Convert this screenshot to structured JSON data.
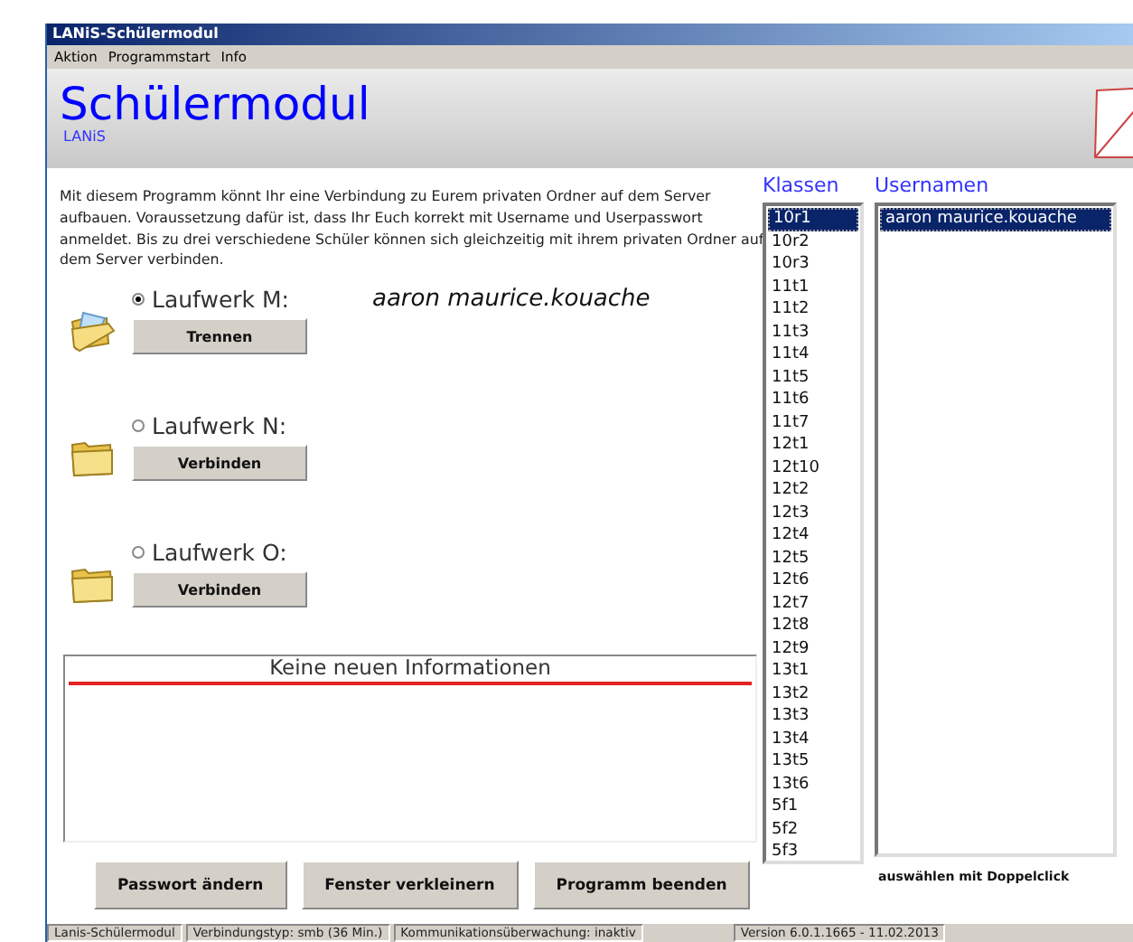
{
  "window": {
    "title": "LANiS-Schülermodul"
  },
  "menu": [
    "Aktion",
    "Programmstart",
    "Info"
  ],
  "header": {
    "title": "Schülermodul",
    "subtitle": "LANiS"
  },
  "description": "Mit diesem Programm könnt Ihr eine Verbindung zu Eurem privaten Ordner auf dem Server aufbauen. Voraussetzung dafür ist, dass Ihr Euch korrekt mit Username und Userpasswort anmeldet. Bis zu drei verschiedene Schüler können sich gleichzeitig mit ihrem privaten Ordner auf dem Server verbinden.",
  "drives": [
    {
      "label": "Laufwerk M:",
      "selected": true,
      "connected": true,
      "user": "aaron maurice.kouache",
      "button": "Trennen"
    },
    {
      "label": "Laufwerk N:",
      "selected": false,
      "connected": false,
      "button": "Verbinden"
    },
    {
      "label": "Laufwerk O:",
      "selected": false,
      "connected": false,
      "button": "Verbinden"
    }
  ],
  "info": {
    "heading": "Keine neuen Informationen"
  },
  "buttons": [
    "Passwort ändern",
    "Fenster verkleinern",
    "Programm beenden"
  ],
  "classes": {
    "label": "Klassen",
    "items": [
      {
        "label": "10r1",
        "selected": true
      },
      {
        "label": "10r2",
        "selected": false
      },
      {
        "label": "10r3",
        "selected": false
      },
      {
        "label": "11t1",
        "selected": false
      },
      {
        "label": "11t2",
        "selected": false
      },
      {
        "label": "11t3",
        "selected": false
      },
      {
        "label": "11t4",
        "selected": false
      },
      {
        "label": "11t5",
        "selected": false
      },
      {
        "label": "11t6",
        "selected": false
      },
      {
        "label": "11t7",
        "selected": false
      },
      {
        "label": "12t1",
        "selected": false
      },
      {
        "label": "12t10",
        "selected": false
      },
      {
        "label": "12t2",
        "selected": false
      },
      {
        "label": "12t3",
        "selected": false
      },
      {
        "label": "12t4",
        "selected": false
      },
      {
        "label": "12t5",
        "selected": false
      },
      {
        "label": "12t6",
        "selected": false
      },
      {
        "label": "12t7",
        "selected": false
      },
      {
        "label": "12t8",
        "selected": false
      },
      {
        "label": "12t9",
        "selected": false
      },
      {
        "label": "13t1",
        "selected": false
      },
      {
        "label": "13t2",
        "selected": false
      },
      {
        "label": "13t3",
        "selected": false
      },
      {
        "label": "13t4",
        "selected": false
      },
      {
        "label": "13t5",
        "selected": false
      },
      {
        "label": "13t6",
        "selected": false
      },
      {
        "label": "5f1",
        "selected": false
      },
      {
        "label": "5f2",
        "selected": false
      },
      {
        "label": "5f3",
        "selected": false
      }
    ]
  },
  "users": {
    "label": "Usernamen",
    "items": [
      {
        "label": "aaron maurice.kouache",
        "selected": true
      }
    ]
  },
  "hint": "auswählen mit Doppelclick",
  "status_bar": [
    "Lanis-Schülermodul",
    "Verbindungstyp: smb  (36 Min.)",
    "Kommunikationsüberwachung: inaktiv",
    "Version 6.0.1.1665 - 11.02.2013"
  ]
}
